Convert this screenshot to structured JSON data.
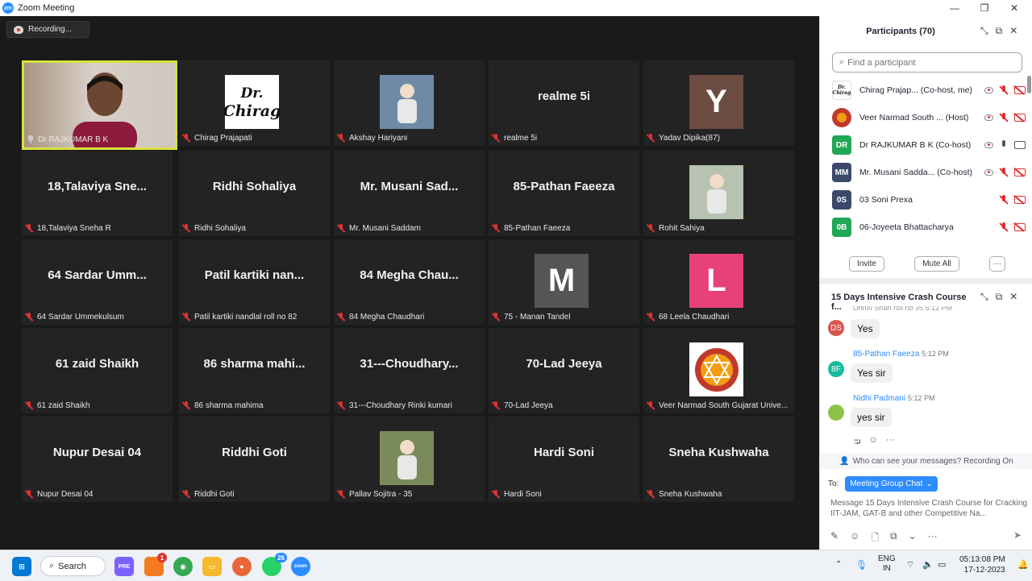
{
  "window": {
    "title": "Zoom Meeting",
    "logo": "zm",
    "minimize": "—",
    "restore": "❐",
    "close": "✕"
  },
  "recording": {
    "label": "Recording..."
  },
  "tiles": [
    {
      "label": "Dr RAJKUMAR B K",
      "type": "video",
      "active": true,
      "pinned": true
    },
    {
      "label": "Chirag Prajapati",
      "type": "logo",
      "logo_line1": "Dr.",
      "logo_line2": "Chirag"
    },
    {
      "label": "Akshay Hariyani",
      "type": "image",
      "bg": "#6e8aa6"
    },
    {
      "label": "realme 5i",
      "type": "name",
      "name": "realme 5i"
    },
    {
      "label": "Yadav Dipika(87)",
      "type": "letter",
      "letter": "Y",
      "bg": "#6d4c41"
    },
    {
      "label": "18,Talaviya Sneha R",
      "type": "name",
      "name": "18,Talaviya  Sne..."
    },
    {
      "label": "Ridhi Sohaliya",
      "type": "name",
      "name": "Ridhi Sohaliya"
    },
    {
      "label": "Mr. Musani Saddam",
      "type": "name",
      "name": "Mr. Musani Sad..."
    },
    {
      "label": "85-Pathan Faeeza",
      "type": "name",
      "name": "85-Pathan Faeeza"
    },
    {
      "label": "Rohit Sahiya",
      "type": "image",
      "bg": "#b7c2b0"
    },
    {
      "label": "64 Sardar Ummekulsum",
      "type": "name",
      "name": "64 Sardar Umm..."
    },
    {
      "label": "Patil kartiki nandlal roll no 82",
      "type": "name",
      "name": "Patil kartiki nan..."
    },
    {
      "label": "84 Megha Chaudhari",
      "type": "name",
      "name": "84 Megha Chau..."
    },
    {
      "label": "75 - Manan Tandel",
      "type": "letter",
      "letter": "M",
      "bg": "#555555"
    },
    {
      "label": "68 Leela Chaudhari",
      "type": "letter",
      "letter": "L",
      "bg": "#e8407a"
    },
    {
      "label": "61 zaid Shaikh",
      "type": "name",
      "name": "61 zaid Shaikh"
    },
    {
      "label": "86 sharma mahima",
      "type": "name",
      "name": "86  sharma  mahi..."
    },
    {
      "label": "31---Choudhary Rinki kumari",
      "type": "name",
      "name": "31---Choudhary..."
    },
    {
      "label": "70-Lad Jeeya",
      "type": "name",
      "name": "70-Lad Jeeya"
    },
    {
      "label": "Veer Narmad South Gujarat Unive...",
      "type": "emblem"
    },
    {
      "label": "Nupur Desai 04",
      "type": "name",
      "name": "Nupur Desai 04"
    },
    {
      "label": "Riddhi Goti",
      "type": "name",
      "name": "Riddhi Goti"
    },
    {
      "label": "Pallav Sojitra - 35",
      "type": "image",
      "bg": "#7a8a5a"
    },
    {
      "label": "Hardi Soni",
      "type": "name",
      "name": "Hardi Soni"
    },
    {
      "label": "Sneha Kushwaha",
      "type": "name",
      "name": "Sneha Kushwaha"
    }
  ],
  "participants": {
    "title": "Participants (70)",
    "search_placeholder": "Find a participant",
    "rows": [
      {
        "initials": "Dr. Chirag",
        "name": "Chirag Prajap... (Co-host, me)",
        "bg": "#ffffff",
        "rec": true,
        "mic": "off",
        "cam": "off"
      },
      {
        "initials": "",
        "name": "Veer Narmad South ... (Host)",
        "bg": "#c0392b",
        "rec": true,
        "mic": "off",
        "cam": "off"
      },
      {
        "initials": "DR",
        "name": "Dr RAJKUMAR B K (Co-host)",
        "bg": "#1fa855",
        "rec": true,
        "mic": "on",
        "cam": "on"
      },
      {
        "initials": "MM",
        "name": "Mr. Musani Sadda... (Co-host)",
        "bg": "#3b4a6b",
        "rec": true,
        "mic": "off",
        "cam": "off"
      },
      {
        "initials": "0S",
        "name": "03 Soni Prexa",
        "bg": "#3b4a6b",
        "rec": false,
        "mic": "off",
        "cam": "off"
      },
      {
        "initials": "0B",
        "name": "06-Joyeeta Bhattacharya",
        "bg": "#1fa855",
        "rec": false,
        "mic": "off",
        "cam": "off"
      }
    ],
    "invite": "Invite",
    "mute_all": "Mute All",
    "more": "···"
  },
  "chat": {
    "title": "15 Days Intensive Crash Course f...",
    "partial_sender": "Dhruv Shah roll no 35  5:12 PM",
    "messages": [
      {
        "avatar": "DS",
        "avatar_bg": "#d9534f",
        "sender": "",
        "time": "",
        "text": "Yes"
      },
      {
        "avatar": "8F",
        "avatar_bg": "#1abc9c",
        "sender": "85-Pathan Faeeza",
        "time": "5:12 PM",
        "text": "Yes sir"
      },
      {
        "avatar": "",
        "avatar_bg": "#8bc34a",
        "sender": "Nidhi Padmani",
        "time": "5:12 PM",
        "text": "yes sir"
      }
    ],
    "visibility_notice": "Who can see your messages? Recording On",
    "to_label": "To:",
    "to_target": "Meeting Group Chat",
    "input_placeholder": "Message 15 Days Intensive Crash Course for Cracking IIT-JAM, GAT-B and other Competitive Na..."
  },
  "taskbar": {
    "search": "Search",
    "lang_top": "ENG",
    "lang_bottom": "IN",
    "time": "05:13:08 PM",
    "date": "17-12-2023",
    "badge_office": "1",
    "badge_whatsapp": "26",
    "zoom_label": "zoom",
    "pre_label": "PRE"
  }
}
